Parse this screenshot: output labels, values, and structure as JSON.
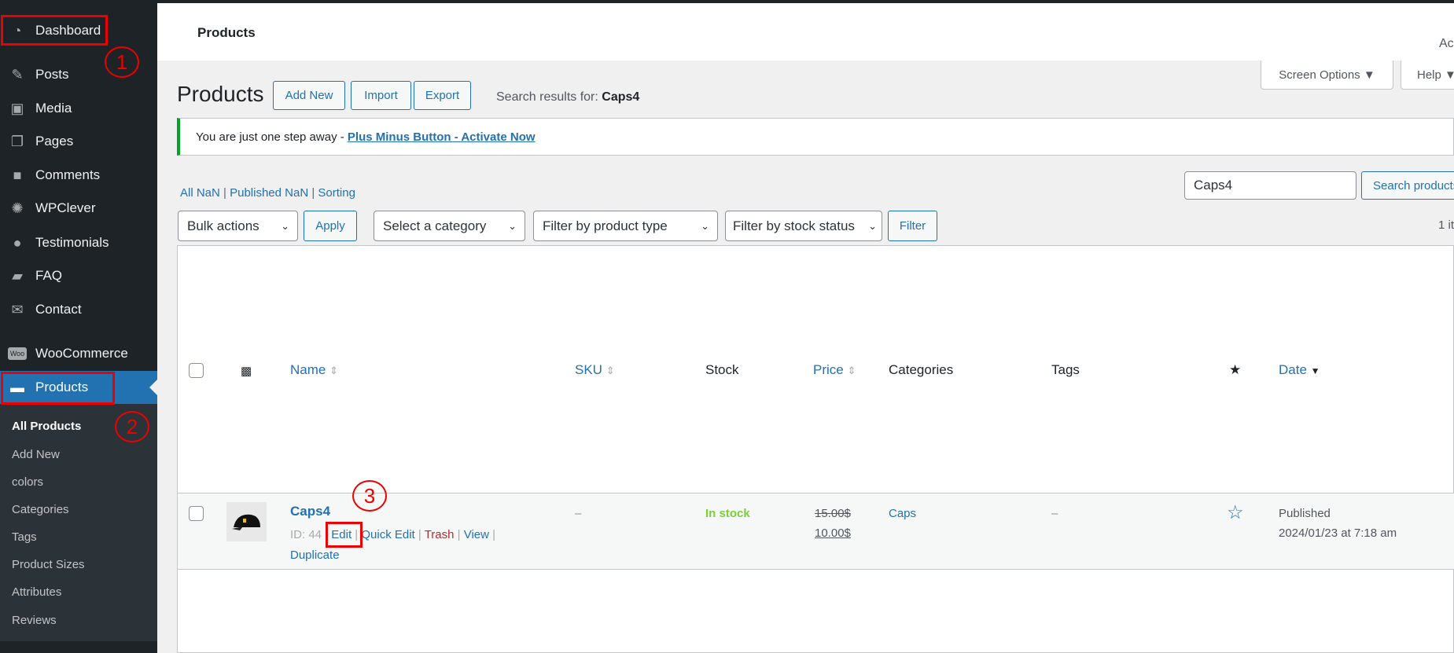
{
  "sidebar": {
    "items": [
      {
        "label": "Dashboard",
        "icon": "dashboard-icon"
      },
      {
        "label": "Posts",
        "icon": "pin-icon"
      },
      {
        "label": "Media",
        "icon": "media-icon"
      },
      {
        "label": "Pages",
        "icon": "pages-icon"
      },
      {
        "label": "Comments",
        "icon": "comment-icon"
      },
      {
        "label": "WPClever",
        "icon": "bulb-icon"
      },
      {
        "label": "Testimonials",
        "icon": "user-icon"
      },
      {
        "label": "FAQ",
        "icon": "folder-icon"
      },
      {
        "label": "Contact",
        "icon": "mail-icon"
      },
      {
        "label": "WooCommerce",
        "icon": "woo-icon",
        "badge": "Woo"
      },
      {
        "label": "Products",
        "icon": "archive-icon"
      }
    ],
    "submenu": [
      "All Products",
      "Add New",
      "colors",
      "Categories",
      "Tags",
      "Product Sizes",
      "Attributes",
      "Reviews"
    ]
  },
  "header": {
    "title": "Products",
    "right_text": "Ac"
  },
  "screen_options": "Screen Options ▼",
  "help": "Help ▼",
  "page": {
    "title": "Products",
    "add_new": "Add New",
    "import": "Import",
    "export": "Export",
    "search_prefix": "Search results for: ",
    "search_term": "Caps4"
  },
  "notice": {
    "text": "You are just one step away - ",
    "link": "Plus Minus Button - Activate Now",
    "accent": "#00a32a"
  },
  "views": {
    "all": "All NaN",
    "published": "Published NaN",
    "sorting": "Sorting"
  },
  "search": {
    "value": "Caps4",
    "button": "Search products"
  },
  "filters": {
    "bulk": "Bulk actions",
    "apply": "Apply",
    "category": "Select a category",
    "type": "Filter by product type",
    "stock": "Filter by stock status",
    "filter": "Filter",
    "count": "1 it"
  },
  "table": {
    "headers": {
      "name": "Name",
      "sku": "SKU",
      "stock": "Stock",
      "price": "Price",
      "categories": "Categories",
      "tags": "Tags",
      "date": "Date"
    },
    "rows": [
      {
        "name": "Caps4",
        "id": "ID: 44",
        "edit": "Edit",
        "quick_edit": "Quick Edit",
        "trash": "Trash",
        "view": "View",
        "duplicate": "Duplicate",
        "sku": "–",
        "stock": "In stock",
        "regular_price": "15.00$",
        "sale_price": "10.00$",
        "categories": "Caps",
        "tags": "–",
        "status": "Published",
        "date": "2024/01/23 at 7:18 am"
      }
    ]
  },
  "annotations": [
    "1",
    "2",
    "3"
  ]
}
